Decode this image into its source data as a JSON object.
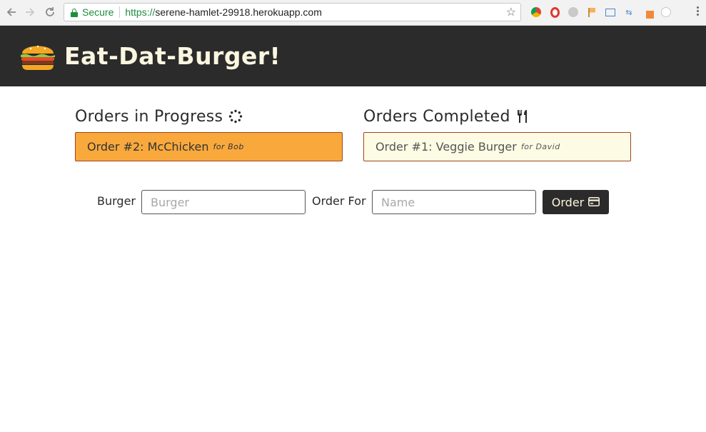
{
  "browser": {
    "secure_label": "Secure",
    "url_scheme": "https://",
    "url_host": "serene-hamlet-29918.herokuapp.com",
    "icons": [
      "back-icon",
      "forward-icon",
      "reload-icon",
      "lock-icon",
      "star-icon",
      "menu-icon"
    ]
  },
  "header": {
    "brand": "Eat-Dat-Burger!",
    "logo_icon": "burger-icon",
    "background": "#2b2b2b",
    "brand_color": "#fbf6e0"
  },
  "in_progress": {
    "title": "Orders in Progress",
    "icon": "spinner-icon",
    "color": "#f9a93c",
    "orders": [
      {
        "label": "Order #2: McChicken",
        "for": "for Bob"
      }
    ]
  },
  "completed": {
    "title": "Orders Completed",
    "icon": "utensils-icon",
    "color": "#fdfbe4",
    "orders": [
      {
        "label": "Order #1: Veggie Burger",
        "for": "for David"
      }
    ]
  },
  "form": {
    "burger_label": "Burger",
    "burger_placeholder": "Burger",
    "burger_value": "",
    "order_for_label": "Order For",
    "name_placeholder": "Name",
    "name_value": "",
    "submit_label": "Order",
    "submit_icon": "credit-card-icon"
  }
}
